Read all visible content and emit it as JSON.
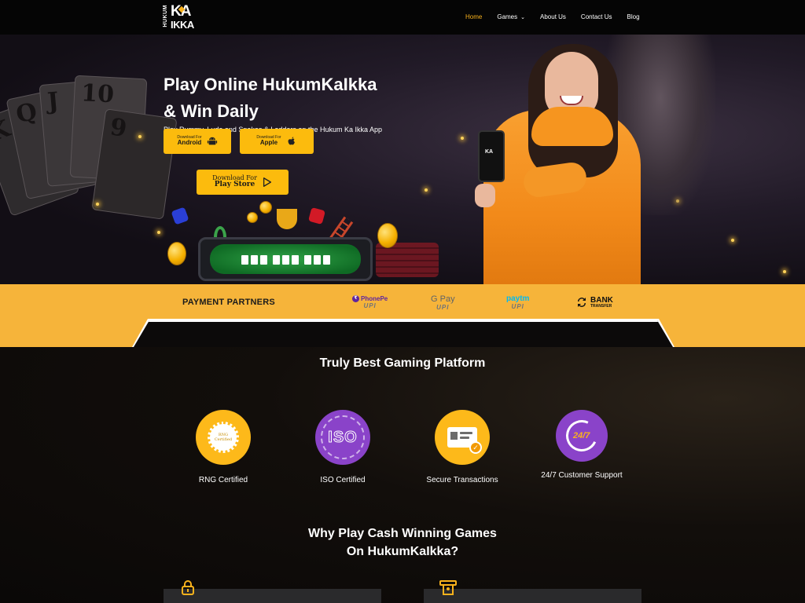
{
  "nav": {
    "logo_top": "HUKUM",
    "logo_ka": "KA",
    "logo_ikka": "IKKA",
    "items": [
      {
        "label": "Home",
        "active": true
      },
      {
        "label": "Games",
        "dropdown": true
      },
      {
        "label": "About Us"
      },
      {
        "label": "Contact Us"
      },
      {
        "label": "Blog"
      }
    ]
  },
  "hero": {
    "title_line1": "Play Online HukumKaIkka",
    "title_line2": "& Win Daily",
    "subtitle": "Play Rummy, Ludo and Snakes & Ladders on the Hukum Ka Ikka App",
    "buttons": {
      "android": {
        "small": "Download For",
        "big": "Android",
        "icon": "android-icon"
      },
      "apple": {
        "small": "Download For",
        "big": "Apple",
        "icon": "apple-icon"
      },
      "playstore": {
        "small": "Download For",
        "big": "Play Store",
        "icon": "play-store-icon"
      }
    },
    "phone_logo": "KA"
  },
  "payment": {
    "label": "PAYMENT PARTNERS",
    "partners": [
      {
        "name": "PhonePe",
        "sub": "UPI"
      },
      {
        "name": "G Pay",
        "sub": "UPI"
      },
      {
        "name": "paytm",
        "sub": "UPI"
      },
      {
        "name": "BANK",
        "sub": "TRANSFER"
      }
    ]
  },
  "platform": {
    "title": "Truly Best Gaming Platform",
    "features": [
      {
        "label": "RNG Certified",
        "badge": "RNG Certified",
        "icon": "rng-seal-icon"
      },
      {
        "label": "ISO Certified",
        "badge": "ISO",
        "icon": "iso-icon"
      },
      {
        "label": "Secure Transactions",
        "icon": "secure-card-icon"
      },
      {
        "label": "24/7 Customer Support",
        "badge": "24/7",
        "icon": "support-clock-icon"
      }
    ]
  },
  "why": {
    "title_line1": "Why Play Cash Winning Games",
    "title_line2": "On HukumKaIkka?"
  },
  "colors": {
    "accent": "#fcbb0d",
    "purple": "#8a43c9",
    "nav_bg": "#050505"
  }
}
